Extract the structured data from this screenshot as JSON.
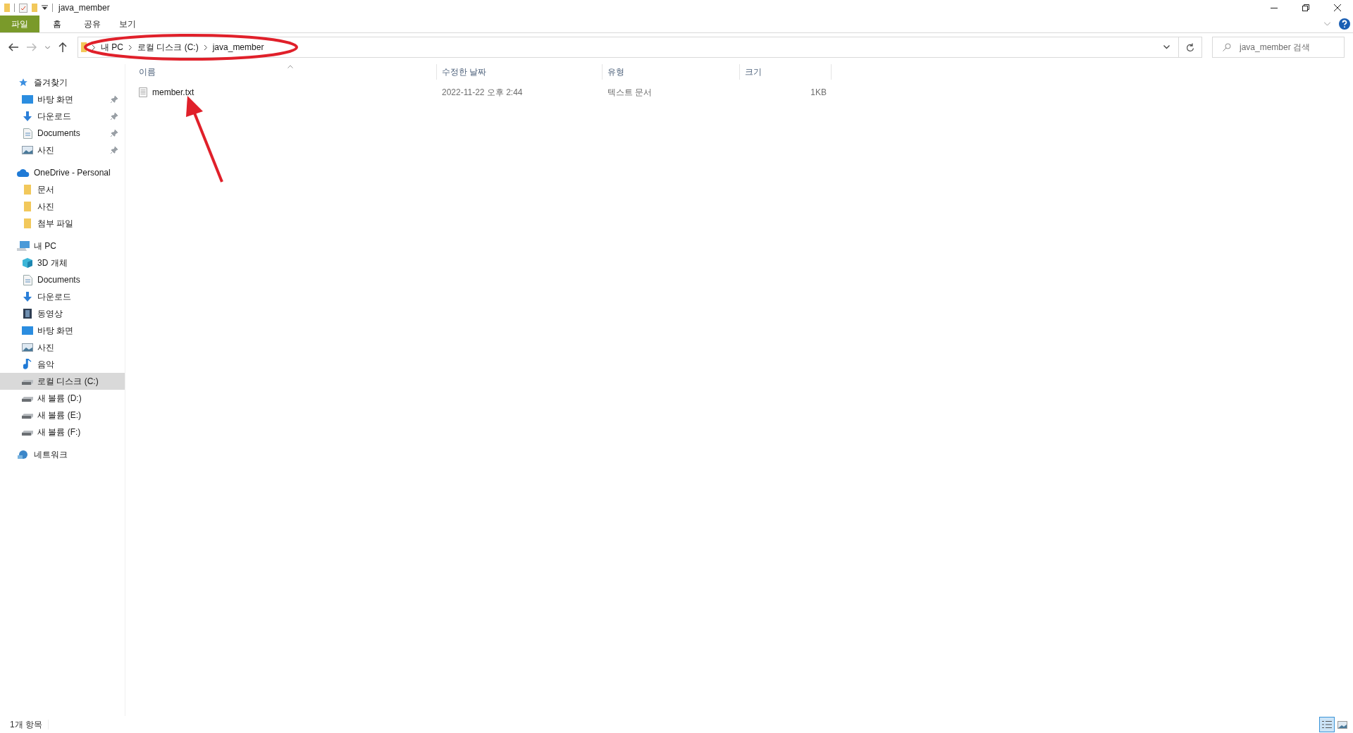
{
  "window": {
    "title": "java_member"
  },
  "ribbon_tabs": [
    {
      "label": "파일",
      "selected": true
    },
    {
      "label": "홈",
      "selected": false
    },
    {
      "label": "공유",
      "selected": false
    },
    {
      "label": "보기",
      "selected": false
    }
  ],
  "address_bar": {
    "breadcrumbs": [
      "내 PC",
      "로컬 디스크 (C:)",
      "java_member"
    ]
  },
  "search": {
    "placeholder": "java_member 검색"
  },
  "sidebar": {
    "sections": [
      {
        "label": "즐겨찾기",
        "kind": "star",
        "children": [
          {
            "label": "바탕 화면",
            "kind": "desktop",
            "pinned": true,
            "selected": false
          },
          {
            "label": "다운로드",
            "kind": "download",
            "pinned": true,
            "selected": false
          },
          {
            "label": "Documents",
            "kind": "document",
            "pinned": true,
            "selected": false
          },
          {
            "label": "사진",
            "kind": "picture",
            "pinned": true,
            "selected": false
          }
        ]
      },
      {
        "label": "OneDrive - Personal",
        "kind": "cloud",
        "children": [
          {
            "label": "문서",
            "kind": "folder",
            "pinned": false,
            "selected": false
          },
          {
            "label": "사진",
            "kind": "folder",
            "pinned": false,
            "selected": false
          },
          {
            "label": "첨부 파일",
            "kind": "folder",
            "pinned": false,
            "selected": false
          }
        ]
      },
      {
        "label": "내 PC",
        "kind": "pc",
        "children": [
          {
            "label": "3D 개체",
            "kind": "cube",
            "pinned": false,
            "selected": false
          },
          {
            "label": "Documents",
            "kind": "document",
            "pinned": false,
            "selected": false
          },
          {
            "label": "다운로드",
            "kind": "download",
            "pinned": false,
            "selected": false
          },
          {
            "label": "동영상",
            "kind": "video",
            "pinned": false,
            "selected": false
          },
          {
            "label": "바탕 화면",
            "kind": "desktop",
            "pinned": false,
            "selected": false
          },
          {
            "label": "사진",
            "kind": "picture",
            "pinned": false,
            "selected": false
          },
          {
            "label": "음악",
            "kind": "music",
            "pinned": false,
            "selected": false
          },
          {
            "label": "로컬 디스크 (C:)",
            "kind": "drive",
            "pinned": false,
            "selected": true
          },
          {
            "label": "새 볼륨 (D:)",
            "kind": "drive",
            "pinned": false,
            "selected": false
          },
          {
            "label": "새 볼륨 (E:)",
            "kind": "drive",
            "pinned": false,
            "selected": false
          },
          {
            "label": "새 볼륨 (F:)",
            "kind": "drive",
            "pinned": false,
            "selected": false
          }
        ]
      },
      {
        "label": "네트워크",
        "kind": "network"
      }
    ]
  },
  "file_list": {
    "columns": [
      "이름",
      "수정한 날짜",
      "유형",
      "크기"
    ],
    "rows": [
      {
        "name": "member.txt",
        "modified": "2022-11-22 오후 2:44",
        "type": "텍스트 문서",
        "size": "1KB"
      }
    ]
  },
  "status_bar": {
    "item_count": "1개 항목"
  }
}
